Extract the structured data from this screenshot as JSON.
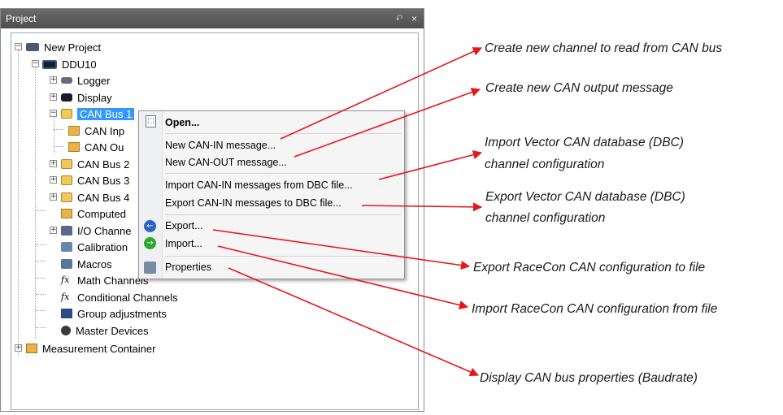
{
  "panel": {
    "title": "Project",
    "pin_glyph": "⮏",
    "close_glyph": "×"
  },
  "tree": {
    "root": "New Project",
    "ddu": "DDU10",
    "logger": "Logger",
    "display": "Display",
    "can_bus_1": "CAN Bus 1",
    "can_in": "CAN Inp",
    "can_out": "CAN Ou",
    "can_bus_2": "CAN Bus 2",
    "can_bus_3": "CAN Bus 3",
    "can_bus_4": "CAN Bus 4",
    "computed": "Computed",
    "io_channels": "I/O Channe",
    "calibration": "Calibration",
    "macros": "Macros",
    "math_channels": "Math Channels",
    "conditional_channels": "Conditional Channels",
    "group_adjustments": "Group adjustments",
    "master_devices": "Master Devices",
    "measurement_container": "Measurement Container",
    "expander_plus": "+",
    "expander_minus": "−"
  },
  "context_menu": {
    "open": "Open...",
    "new_can_in": "New CAN-IN message...",
    "new_can_out": "New CAN-OUT message...",
    "import_dbc": "Import CAN-IN messages from DBC file...",
    "export_dbc": "Export CAN-IN messages to DBC file...",
    "export": "Export...",
    "import": "Import...",
    "properties": "Properties"
  },
  "annotations": {
    "create_channel": "Create new channel to read from CAN bus",
    "create_output": "Create new CAN output message",
    "import_vector_1": "Import Vector CAN database (DBC)",
    "import_vector_2": "channel configuration",
    "export_vector_1": "Export Vector CAN database (DBC)",
    "export_vector_2": "channel configuration",
    "export_racecon": "Export RaceCon CAN configuration to file",
    "import_racecon": "Import RaceCon CAN configuration from file",
    "display_props": "Display CAN bus properties (Baudrate)"
  },
  "colors": {
    "arrow": "#e8161b",
    "selection": "#3399ff",
    "panel_header": "#5a5a5a"
  },
  "icons": {
    "open": "open-document-icon",
    "export": "arrow-left-circle-icon",
    "import": "arrow-right-circle-icon",
    "properties": "properties-icon"
  }
}
